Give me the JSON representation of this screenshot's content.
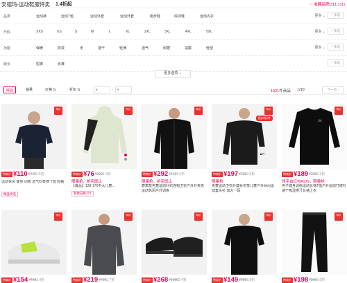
{
  "header": {
    "brand_title": "安德玛-运动鞋服特卖",
    "discount": "1.4折起",
    "fav_label": "♡ 收藏品牌(311,311)"
  },
  "filters": [
    {
      "label": "品类",
      "options": [
        "运动裤",
        "运动T恤",
        "运动外套",
        "运动外套",
        "跑步鞋",
        "综训鞋",
        "运动内衣"
      ]
    },
    {
      "label": "尺码",
      "options": [
        "XXS",
        "XS",
        "S",
        "M",
        "L",
        "XL",
        "2XL",
        "3XL",
        "4XL",
        "5XL"
      ]
    },
    {
      "label": "功能",
      "options": [
        "保暖",
        "防泼",
        "无",
        "速干",
        "轻薄",
        "透气",
        "耐磨",
        "减震",
        "轻便"
      ]
    },
    {
      "label": "版长",
      "options": [
        "短裤",
        "长裤"
      ]
    }
  ],
  "filter_more": "更多 ⌄",
  "filter_multi": "+ 多选",
  "more_options": "更多选项 ⌄",
  "sortbar": {
    "sort_items": [
      "综合",
      "销量",
      "价格 ⇅",
      "折扣 ⇅"
    ],
    "price_from": "¥",
    "price_to": "¥",
    "price_dash": "-",
    "result_count": "1921",
    "result_suffix": "件商品",
    "page_current": "1",
    "page_total": "/10",
    "next_label": "下一页 ›"
  },
  "products": [
    {
      "tag": "特卖价",
      "price": "¥110",
      "orig": "¥449",
      "disc": "2.5折",
      "promo": "",
      "title": "运动休闲 健身 训练 透气科技感 T恤 短袖",
      "sold": "精品优选",
      "badge": "特价"
    },
    {
      "tag": "特卖价",
      "price": "¥76",
      "orig": "¥399",
      "disc": "1.9折",
      "promo": "限量抢，抢完即止",
      "title": "【爆品】128-176中大儿童…",
      "sold": "新款已抢473",
      "badge": "特价"
    },
    {
      "tag": "特卖价",
      "price": "¥292",
      "orig": "¥449",
      "disc": "6.5折",
      "promo": "限量抢，抢完即止",
      "title": "春季款男童运动针织连帽卫衣户外外夹克运动休闲户外训练",
      "sold": "",
      "badge": "特价"
    },
    {
      "tag": "特卖价",
      "price": "¥197",
      "orig": "¥799",
      "disc": "2.5折",
      "promo": "限量抢",
      "title": "男童运动卫衣外套秋冬季儿童户外休闲运动套头衫 加大一码",
      "sold": "",
      "badge": "特价",
      "promo_tag": "低价抢1件"
    },
    {
      "tag": "特卖价",
      "price": "¥189",
      "orig": "¥299",
      "disc": "6.3折",
      "promo": "领平台红包¥179，限量抢",
      "title": "男子健身训练运动长袖T恤户外运动打底衫速干吸湿排汗长袖上衣",
      "sold": "",
      "badge": "特价"
    },
    {
      "tag": "特卖价",
      "price": "¥154",
      "orig": "¥450",
      "disc": "3.4折",
      "promo": "",
      "title": "",
      "sold": "",
      "badge": "特价"
    },
    {
      "tag": "特卖价",
      "price": "¥219",
      "orig": "¥799",
      "disc": "2.7折",
      "promo": "",
      "title": "",
      "sold": "",
      "badge": "特价"
    },
    {
      "tag": "特卖价",
      "price": "¥268",
      "orig": "¥1099",
      "disc": "2.4折",
      "promo": "",
      "title": "",
      "sold": "",
      "badge": "特价"
    },
    {
      "tag": "特卖价",
      "price": "¥149",
      "orig": "¥259",
      "disc": "5.8折",
      "promo": "",
      "title": "",
      "sold": "",
      "badge": "特价"
    },
    {
      "tag": "特卖价",
      "price": "¥198",
      "orig": "¥299",
      "disc": "6.6折",
      "promo": "",
      "title": "",
      "sold": "",
      "badge": "特价"
    }
  ],
  "colors": {
    "accent": "#e5004f",
    "tag_red": "#e8322f"
  }
}
